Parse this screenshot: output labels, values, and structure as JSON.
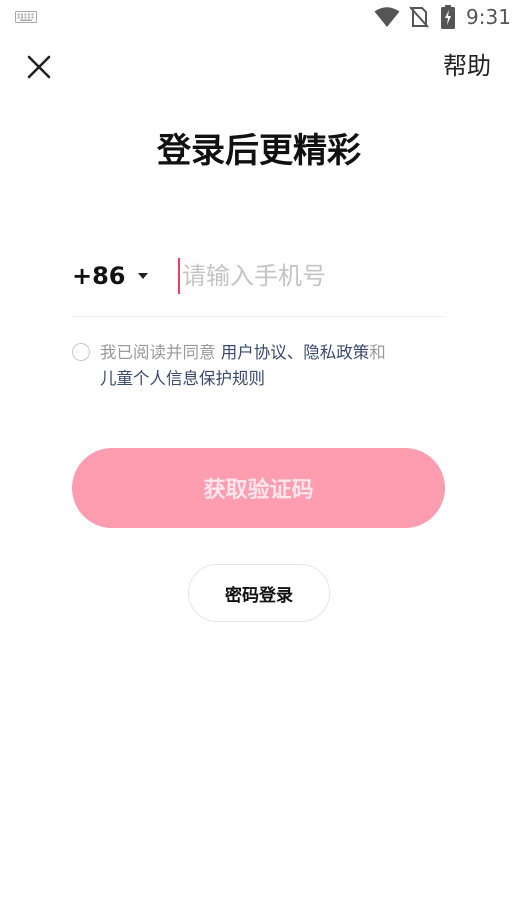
{
  "status_bar": {
    "time": "9:31",
    "icons": [
      "keyboard-icon",
      "wifi-icon",
      "no-sim-icon",
      "battery-charging-icon"
    ]
  },
  "header": {
    "close_icon": "close-icon",
    "help_label": "帮助"
  },
  "title": "登录后更精彩",
  "phone": {
    "country_code": "+86",
    "placeholder": "请输入手机号",
    "value": ""
  },
  "agreement": {
    "checked": false,
    "prefix": "我已阅读并同意 ",
    "user_agreement": "用户协议",
    "separator": "、",
    "privacy_policy": "隐私政策",
    "conjunction": "和",
    "child_policy": "儿童个人信息保护规则"
  },
  "actions": {
    "get_code_label": "获取验证码",
    "password_login_label": "密码登录"
  },
  "colors": {
    "primary_button": "#fe9cb0",
    "primary_button_text": "#fde6ec",
    "cursor": "#e8405e",
    "link": "#3a4a6e",
    "muted_text": "#9a9a9a",
    "placeholder": "#c4c4c4"
  }
}
